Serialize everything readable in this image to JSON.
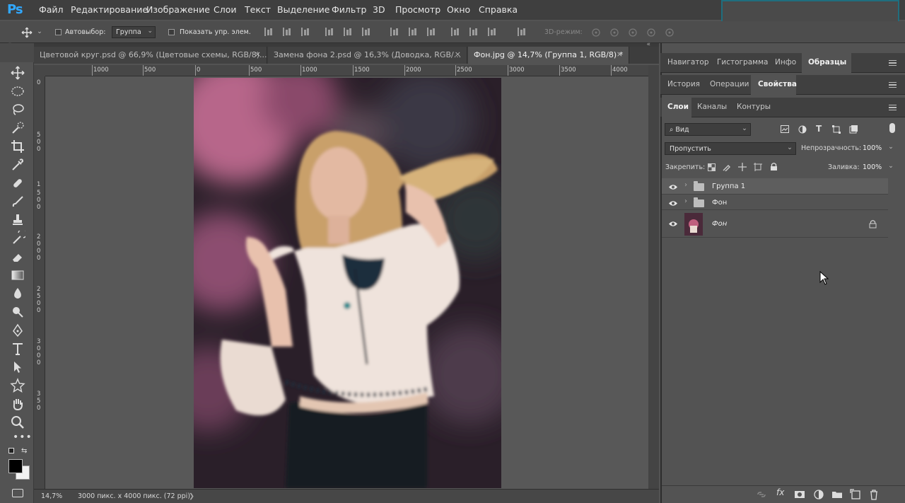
{
  "app": {
    "logo": "Ps"
  },
  "menu": [
    "Файл",
    "Редактирование",
    "Изображение",
    "Слои",
    "Текст",
    "Выделение",
    "Фильтр",
    "3D",
    "Просмотр",
    "Окно",
    "Справка"
  ],
  "options": {
    "autoselect_label": "Автовыбор:",
    "autoselect_value": "Группа",
    "show_controls_label": "Показать упр. элем.",
    "mode3d_label": "3D-режим:"
  },
  "tabs": [
    {
      "label": "Цветовой круг.psd @ 66,9% (Цветовые схемы, RGB/8)...",
      "close": "×",
      "active": false
    },
    {
      "label": "Замена фона 2.psd @ 16,3% (Доводка, RGB/...",
      "close": "×",
      "active": false
    },
    {
      "label": "Фон.jpg @ 14,7% (Группа 1, RGB/8) *",
      "close": "×",
      "active": true
    }
  ],
  "ruler": {
    "h_ticks": [
      "1000",
      "500",
      "0",
      "500",
      "1000",
      "1500",
      "2000",
      "2500",
      "3000",
      "3500",
      "4000"
    ],
    "v_ticks": [
      "0",
      "5",
      "0",
      "0",
      "1",
      "5",
      "0",
      "0",
      "2",
      "0",
      "0",
      "0",
      "2",
      "5",
      "0",
      "0",
      "3",
      "0",
      "0",
      "0",
      "3",
      "5",
      "0"
    ]
  },
  "status": {
    "zoom": "14,7%",
    "doc_info": "3000 пикс. x 4000 пикс. (72 ppi)",
    "arrow": "❯"
  },
  "panels": {
    "row1": [
      "Навигатор",
      "Гистограмма",
      "Инфо",
      "Образцы"
    ],
    "row1_active": 3,
    "row2": [
      "История",
      "Операции",
      "Свойства"
    ],
    "row2_active": 2,
    "row3": [
      "Слои",
      "Каналы",
      "Контуры"
    ],
    "row3_active": 0
  },
  "layers_panel": {
    "filter_value": "Вид",
    "blend_mode": "Пропустить",
    "opacity_label": "Непрозрачность:",
    "opacity_value": "100%",
    "lock_label": "Закрепить:",
    "fill_label": "Заливка:",
    "fill_value": "100%",
    "layers": [
      {
        "name": "Группа 1",
        "type": "group",
        "selected": true,
        "locked": false
      },
      {
        "name": "Фон",
        "type": "group",
        "selected": false,
        "locked": false
      },
      {
        "name": "Фон",
        "type": "image",
        "selected": false,
        "locked": true
      }
    ]
  },
  "bottom_icons": [
    "link-icon",
    "fx-icon",
    "mask-icon",
    "adjustment-icon",
    "new-group-icon",
    "new-layer-icon",
    "trash-icon"
  ],
  "colors": {
    "accent": "#31a8ff",
    "bg": "#535353",
    "menubar": "#3f3f3f"
  }
}
